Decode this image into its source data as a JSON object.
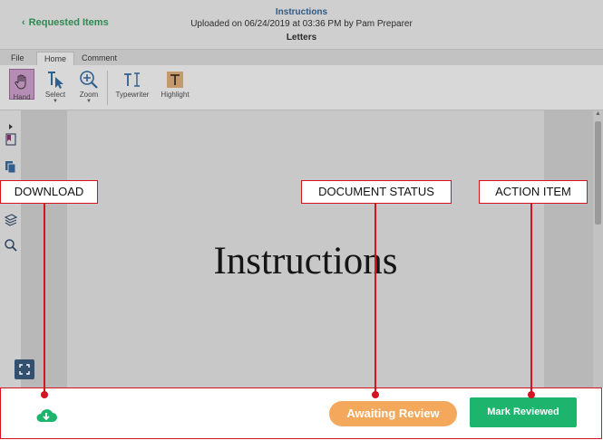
{
  "header": {
    "back_label": "Requested Items",
    "title": "Instructions",
    "subtitle": "Uploaded on 06/24/2019 at 03:36 PM by Pam Preparer",
    "category": "Letters"
  },
  "tabs": [
    {
      "label": "File",
      "active": false
    },
    {
      "label": "Home",
      "active": true
    },
    {
      "label": "Comment",
      "active": false
    }
  ],
  "toolbar": {
    "hand": "Hand",
    "select": "Select",
    "zoom": "Zoom",
    "typewriter": "Typewriter",
    "highlight": "Highlight"
  },
  "document": {
    "heading": "Instructions"
  },
  "actions": {
    "status": "Awaiting Review",
    "mark_reviewed": "Mark Reviewed"
  },
  "annotations": {
    "download": "DOWNLOAD",
    "document_status": "DOCUMENT STATUS",
    "action_item": "ACTION ITEM"
  },
  "colors": {
    "accent_green": "#1db56e",
    "status_orange": "#f4a85b",
    "annotation_red": "#d41420",
    "title_blue": "#2d5a86"
  }
}
